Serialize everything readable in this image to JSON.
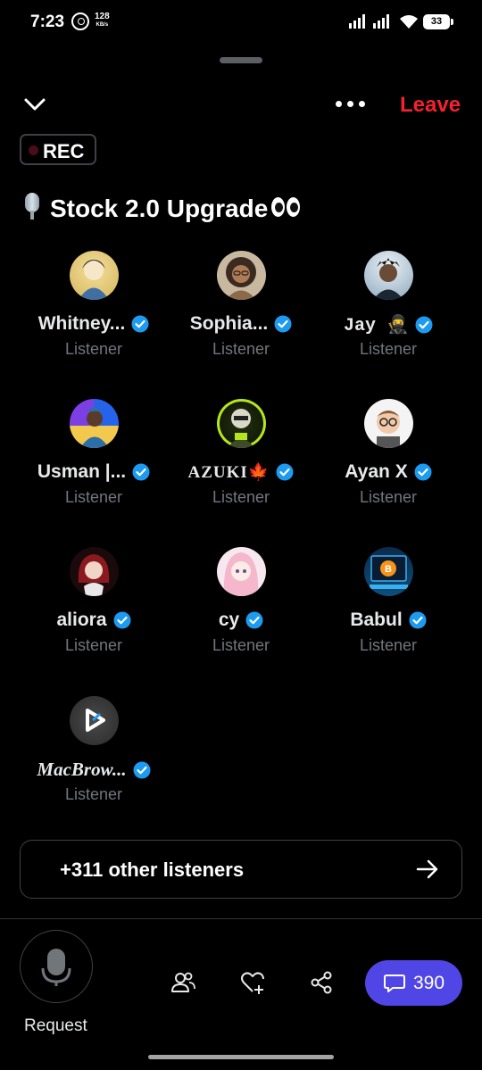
{
  "status_bar": {
    "time": "7:23",
    "speed_value": "128",
    "speed_unit": "KB/s",
    "battery": "33"
  },
  "header": {
    "leave_label": "Leave",
    "rec_label": "REC",
    "title": "Stock 2.0 Upgrade"
  },
  "listeners": [
    {
      "name": "Whitney...",
      "role": "Listener",
      "verified": true
    },
    {
      "name": "Sophia...",
      "role": "Listener",
      "verified": true
    },
    {
      "name": "Jay 🥷",
      "role": "Listener",
      "verified": true
    },
    {
      "name": "Usman |...",
      "role": "Listener",
      "verified": true
    },
    {
      "name": "AZUKI🍁",
      "role": "Listener",
      "verified": true
    },
    {
      "name": "Ayan X",
      "role": "Listener",
      "verified": true
    },
    {
      "name": "aliora",
      "role": "Listener",
      "verified": true
    },
    {
      "name": "cy",
      "role": "Listener",
      "verified": true
    },
    {
      "name": "Babul",
      "role": "Listener",
      "verified": true
    },
    {
      "name": "MacBrow...",
      "role": "Listener",
      "verified": true
    }
  ],
  "others": {
    "label": "+311 other listeners"
  },
  "bottom_bar": {
    "request_label": "Request",
    "comment_count": "390"
  },
  "colors": {
    "leave": "#f4212e",
    "verified": "#1d9bf0",
    "comment_button": "#5046e5",
    "muted_text": "#71767b"
  }
}
